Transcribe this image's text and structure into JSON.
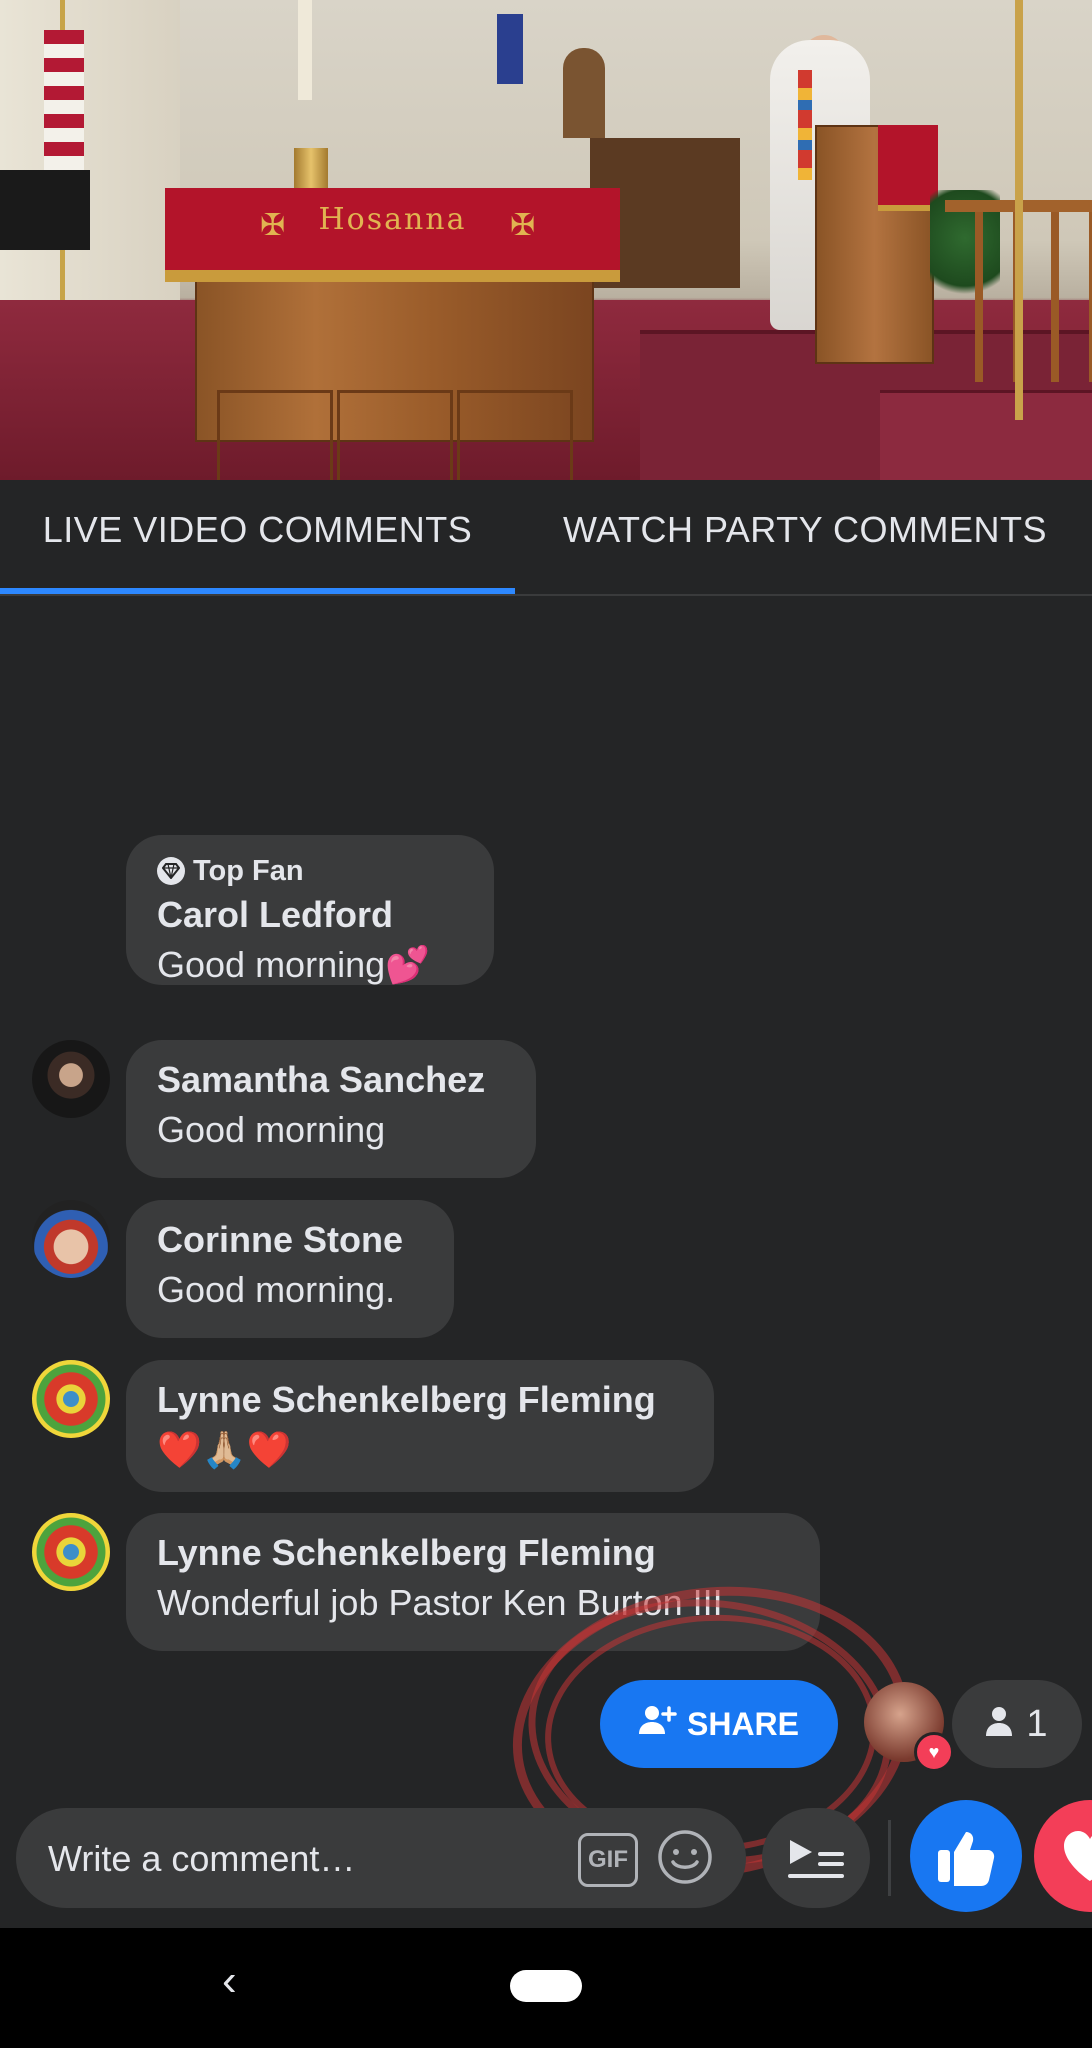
{
  "tabs": [
    {
      "label": "LIVE VIDEO COMMENTS",
      "active": true
    },
    {
      "label": "WATCH PARTY COMMENTS",
      "active": false
    }
  ],
  "video": {
    "altar_text": "Hosanna"
  },
  "comments": [
    {
      "badge": "Top Fan",
      "name": "Carol Ledford",
      "text": "Good morning💕"
    },
    {
      "name": "Samantha Sanchez",
      "text": "Good morning"
    },
    {
      "name": "Corinne Stone",
      "text": "Good morning."
    },
    {
      "name": "Lynne Schenkelberg Fleming",
      "text": "❤️🙏🏼❤️"
    },
    {
      "name": "Lynne Schenkelberg Fleming",
      "text": "Wonderful job Pastor Ken Burton III"
    }
  ],
  "share": {
    "label": "SHARE"
  },
  "viewers": {
    "count": "1"
  },
  "composer": {
    "placeholder": "Write a comment…",
    "gif_label": "GIF"
  },
  "colors": {
    "accent": "#1877f2",
    "love": "#f33e58",
    "background": "#242526",
    "bubble": "#3a3b3c",
    "tab_underline": "#2d88ff"
  },
  "icons": [
    "diamond-icon",
    "add-person-icon",
    "person-icon",
    "heart-icon",
    "gif-icon",
    "emoji-icon",
    "playlist-icon",
    "like-icon",
    "love-icon",
    "back-icon",
    "home-icon"
  ]
}
